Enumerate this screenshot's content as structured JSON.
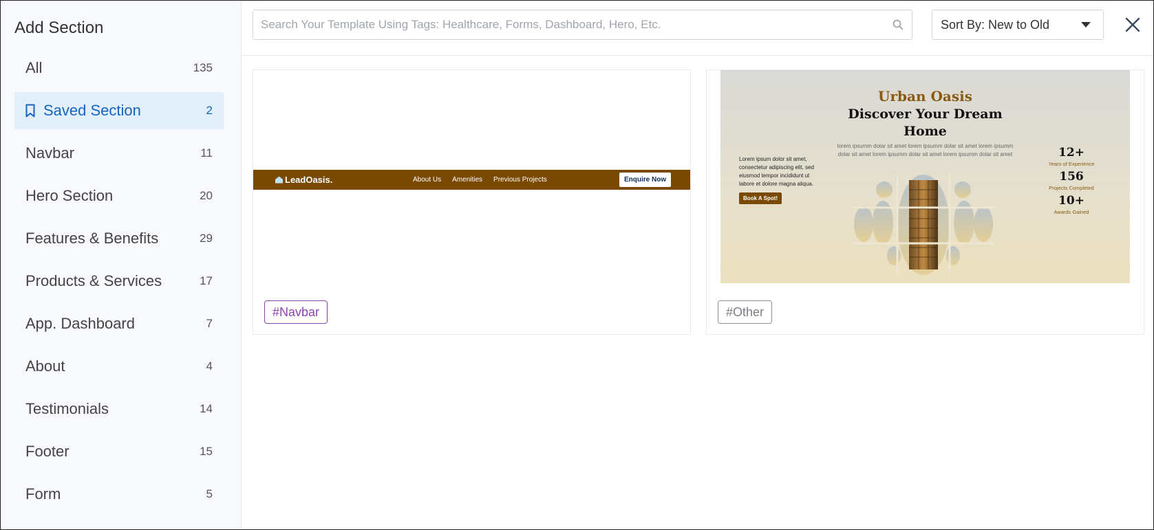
{
  "sidebar": {
    "title": "Add Section",
    "items": [
      {
        "label": "All",
        "count": "135"
      },
      {
        "label": "Saved Section",
        "count": "2",
        "icon": "bookmark-icon",
        "active": true
      },
      {
        "label": "Navbar",
        "count": "11"
      },
      {
        "label": "Hero Section",
        "count": "20"
      },
      {
        "label": "Features & Benefits",
        "count": "29"
      },
      {
        "label": "Products & Services",
        "count": "17"
      },
      {
        "label": "App. Dashboard",
        "count": "7"
      },
      {
        "label": "About",
        "count": "4"
      },
      {
        "label": "Testimonials",
        "count": "14"
      },
      {
        "label": "Footer",
        "count": "15"
      },
      {
        "label": "Form",
        "count": "5"
      }
    ]
  },
  "toolbar": {
    "search_placeholder": "Search Your Template Using Tags: Healthcare, Forms, Dashboard, Hero, Etc.",
    "search_value": "",
    "sort_label": "Sort By: New to Old",
    "close_icon": "close-icon"
  },
  "cards": [
    {
      "tag": "#Navbar",
      "preview": {
        "logo": "LeadOasis.",
        "links": [
          "About Us",
          "Amenities",
          "Previous Projects"
        ],
        "cta": "Enquire Now"
      }
    },
    {
      "tag": "#Other",
      "preview": {
        "eyebrow": "Urban Oasis",
        "title_line1": "Discover Your Dream",
        "title_line2": "Home",
        "lorem": "lorem ipsumm dolar sit amet lorem ipsumm dolar sit amet lorem ipsumm dolar sit amet lorem ipsumm dolar sit amet lorem ipsumm dolar sit amet",
        "desc": "Lorem ipsum dolor sit amet, consectetur adipiscing elit, sed eiusmod tempor incididunt ut labore et dolore magna aliqua.",
        "button": "Book A Spot!",
        "stats": [
          {
            "value": "12+",
            "label": "Years of Experience"
          },
          {
            "value": "156",
            "label": "Projects Completed"
          },
          {
            "value": "10+",
            "label": "Awards Gained"
          }
        ]
      }
    }
  ],
  "colors": {
    "accent": "#1565c0",
    "active_bg": "#e3eefb",
    "brand_brown": "#7a4a05",
    "tag_purple": "#8e44ad",
    "tag_gray": "#8a8f96"
  }
}
